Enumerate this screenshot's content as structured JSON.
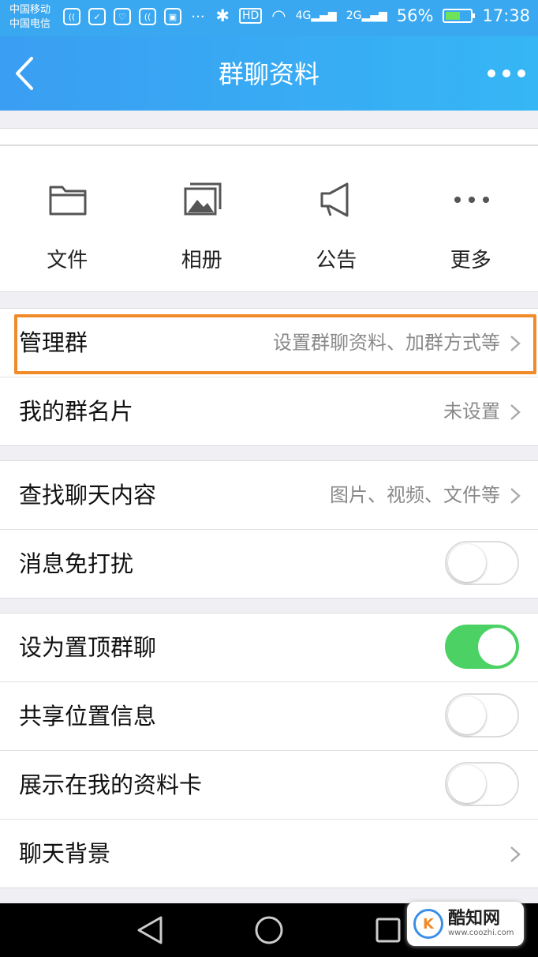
{
  "status_bar": {
    "carrier1": "中国移动",
    "carrier2": "中国电信",
    "hd": "HD",
    "net1": "4G",
    "net2": "2G",
    "battery_percent": "56%",
    "time": "17:38"
  },
  "nav": {
    "title": "群聊资料"
  },
  "quick_actions": [
    {
      "label": "文件",
      "icon": "folder-icon"
    },
    {
      "label": "相册",
      "icon": "photo-album-icon"
    },
    {
      "label": "公告",
      "icon": "megaphone-icon"
    },
    {
      "label": "更多",
      "icon": "more-dots-icon"
    }
  ],
  "groups": {
    "manage": [
      {
        "label": "管理群",
        "value": "设置群聊资料、加群方式等"
      },
      {
        "label": "我的群名片",
        "value": "未设置"
      }
    ],
    "chat": [
      {
        "label": "查找聊天内容",
        "value": "图片、视频、文件等"
      },
      {
        "label": "消息免打扰",
        "toggle": false
      }
    ],
    "settings": [
      {
        "label": "设为置顶群聊",
        "toggle": true
      },
      {
        "label": "共享位置信息",
        "toggle": false
      },
      {
        "label": "展示在我的资料卡",
        "toggle": false
      },
      {
        "label": "聊天背景"
      }
    ]
  },
  "watermark": {
    "logo": "K",
    "name": "酷知网",
    "url": "www.coozhi.com"
  },
  "colors": {
    "nav_blue": "#3aa8f0",
    "toggle_on": "#4cd264",
    "highlight": "#f08b2a"
  }
}
